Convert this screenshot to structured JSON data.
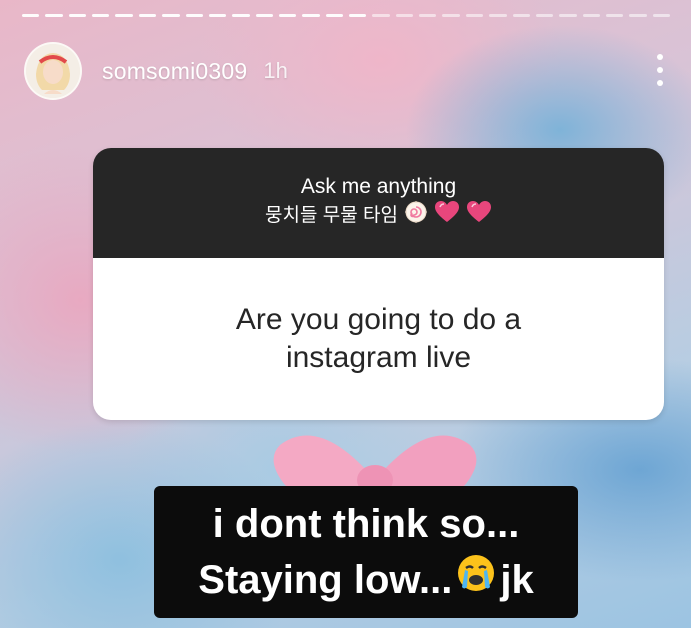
{
  "story": {
    "username": "somsomi0309",
    "time": "1h",
    "progress_segments": [
      1,
      1,
      1,
      1,
      1,
      1,
      1,
      1,
      1,
      1,
      1,
      1,
      1,
      1,
      1,
      0,
      0,
      0,
      0,
      0,
      0,
      0,
      0,
      0,
      0,
      0,
      0,
      0
    ],
    "more_icon": "more-vertical-icon"
  },
  "question_sticker": {
    "title": "Ask me anything",
    "subtitle": "뭉치들 무물 타임",
    "subtitle_emojis": [
      "fish-cake-icon",
      "heart-icon",
      "heart-icon"
    ],
    "question": "Are you going to do a instagram live"
  },
  "caption": {
    "line1": "i dont think so...",
    "line2_text": "Staying low...",
    "line2_emoji": "crying-face-icon",
    "line2_suffix": "jk"
  },
  "colors": {
    "sticker_header": "#262626",
    "caption_bg": "#0c0c0c",
    "heart": "#e8467c"
  }
}
